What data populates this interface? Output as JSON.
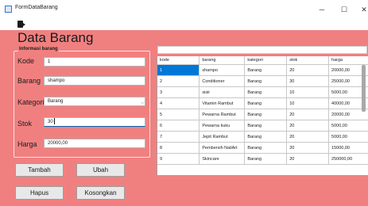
{
  "window": {
    "title": "FormDataBarang",
    "minimize": "─",
    "maximize": "☐",
    "close": "✕"
  },
  "page_title": "Data Barang",
  "form": {
    "group_label": "Informasi barang",
    "kode_label": "Kode",
    "kode_value": "1",
    "barang_label": "Barang",
    "barang_value": "shampo",
    "kategori_label": "Kategori",
    "kategori_value": "Barang",
    "stok_label": "Stok",
    "stok_value": "30",
    "harga_label": "Harga",
    "harga_value": "20000,00"
  },
  "buttons": {
    "tambah": "Tambah",
    "ubah": "Ubah",
    "hapus": "Hapus",
    "kosongkan": "Kosongkan"
  },
  "icons": {
    "app": "form-icon",
    "exit": "exit-door-icon",
    "dropdown": "chevron-down-icon"
  },
  "colors": {
    "background": "#f08080",
    "selection": "#0078d7"
  },
  "table": {
    "headers": [
      "kode",
      "barang",
      "kategori",
      "stok",
      "harga"
    ],
    "rows": [
      [
        "1",
        "shampo",
        "Barang",
        "20",
        "20000,00"
      ],
      [
        "2",
        "Conditioner",
        "Barang",
        "30",
        "25000,00"
      ],
      [
        "3",
        "sisir",
        "Barang",
        "10",
        "5000,00"
      ],
      [
        "4",
        "Vitamin Rambut",
        "Barang",
        "10",
        "40000,00"
      ],
      [
        "5",
        "Pewarna Rambut",
        "Barang",
        "20",
        "20000,00"
      ],
      [
        "6",
        "Pewarna kuku",
        "Barang",
        "20",
        "5000,00"
      ],
      [
        "7",
        "Jepit Rambut",
        "Barang",
        "20",
        "5000,00"
      ],
      [
        "8",
        "Pembersih NailArt",
        "Barang",
        "20",
        "15000,00"
      ],
      [
        "9",
        "Skincare",
        "Barang",
        "20",
        "250000,00"
      ]
    ]
  }
}
